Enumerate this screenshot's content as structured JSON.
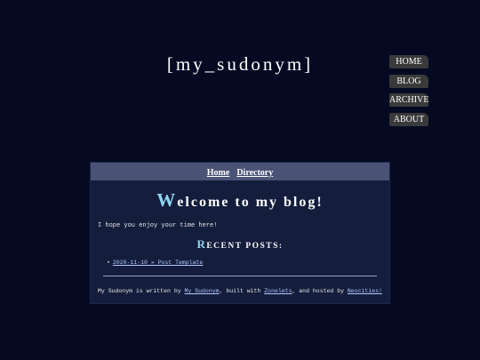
{
  "site": {
    "title": "[my_sudonym]"
  },
  "nav": {
    "items": [
      {
        "label": "HOME"
      },
      {
        "label": "BLOG"
      },
      {
        "label": "ARCHIVE"
      },
      {
        "label": "ABOUT"
      }
    ]
  },
  "header": {
    "links": [
      {
        "label": "Home"
      },
      {
        "label": "Directory"
      }
    ]
  },
  "main": {
    "welcome_first": "W",
    "welcome_rest": "elcome to my blog!",
    "intro": "I hope you enjoy your time here!",
    "recent_first": "R",
    "recent_rest": "ECENT POSTS:",
    "posts": [
      {
        "link": "2020-11-10 » Post Template"
      }
    ]
  },
  "footer": {
    "part1": "My Sudonym is written by ",
    "link1": "My Sudonym",
    "part2": ", built with ",
    "link2": "Zonelets",
    "part3": ", and hosted by ",
    "link3": "Neocities!"
  },
  "colors": {
    "background": "#050a22",
    "panel": "#141d3c",
    "header_bar": "#4a5275",
    "accent": "#8fd6f2",
    "nav_button": "#3a3a3a"
  }
}
